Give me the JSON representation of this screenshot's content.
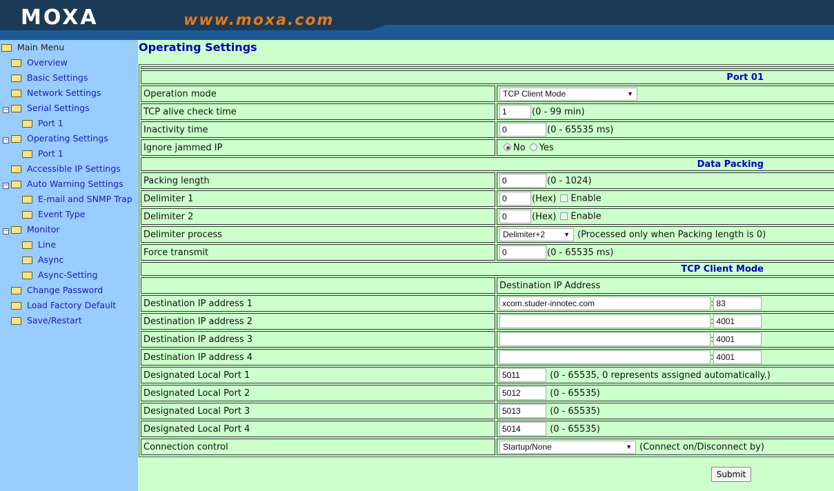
{
  "header": {
    "logo": "MOXA",
    "url": "www.moxa.com"
  },
  "sidebar": {
    "items": [
      {
        "label": "Main Menu",
        "level": 0,
        "root": true,
        "open": true
      },
      {
        "label": "Overview",
        "level": 1
      },
      {
        "label": "Basic Settings",
        "level": 1
      },
      {
        "label": "Network Settings",
        "level": 1
      },
      {
        "label": "Serial Settings",
        "level": 1,
        "open": true
      },
      {
        "label": "Port 1",
        "level": 2
      },
      {
        "label": "Operating Settings",
        "level": 1,
        "open": true
      },
      {
        "label": "Port 1",
        "level": 2
      },
      {
        "label": "Accessible IP Settings",
        "level": 1
      },
      {
        "label": "Auto Warning Settings",
        "level": 1,
        "open": true
      },
      {
        "label": "E-mail and SNMP Trap",
        "level": 2
      },
      {
        "label": "Event Type",
        "level": 2
      },
      {
        "label": "Monitor",
        "level": 1,
        "open": true
      },
      {
        "label": "Line",
        "level": 2
      },
      {
        "label": "Async",
        "level": 2
      },
      {
        "label": "Async-Setting",
        "level": 2
      },
      {
        "label": "Change Password",
        "level": 1
      },
      {
        "label": "Load Factory Default",
        "level": 1
      },
      {
        "label": "Save/Restart",
        "level": 1
      }
    ]
  },
  "page": {
    "title": "Operating Settings",
    "submit": "Submit"
  },
  "rows": [
    {
      "type": "blank"
    },
    {
      "type": "sec",
      "label": "Port 01"
    },
    {
      "type": "select",
      "label": "Operation mode",
      "value": "TCP Client Mode",
      "w": 200
    },
    {
      "type": "input",
      "label": "TCP alive check time",
      "value": "1",
      "w": 46,
      "hint": "(0 - 99 min)"
    },
    {
      "type": "input",
      "label": "Inactivity time",
      "value": "0",
      "w": 68,
      "hint": "(0 - 65535 ms)"
    },
    {
      "type": "radio",
      "label": "Ignore jammed IP",
      "options": [
        "No",
        "Yes"
      ],
      "selected": "No"
    },
    {
      "type": "sec",
      "label": "Data Packing"
    },
    {
      "type": "input",
      "label": "Packing length",
      "value": "0",
      "w": 68,
      "hint": "(0 - 1024)"
    },
    {
      "type": "input",
      "label": "Delimiter 1",
      "value": "0",
      "w": 46,
      "hint": "(Hex)",
      "check": "Enable"
    },
    {
      "type": "input",
      "label": "Delimiter 2",
      "value": "0",
      "w": 46,
      "hint": "(Hex)",
      "check": "Enable"
    },
    {
      "type": "select",
      "label": "Delimiter process",
      "value": "Delimiter+2",
      "w": 108,
      "hint": "(Processed only when Packing length is 0)"
    },
    {
      "type": "input",
      "label": "Force transmit",
      "value": "0",
      "w": 68,
      "hint": "(0 - 65535 ms)"
    },
    {
      "type": "sec",
      "label": "TCP Client Mode"
    },
    {
      "type": "text",
      "label": "",
      "value": "Destination IP Address"
    },
    {
      "type": "ip",
      "label": "Destination IP address 1",
      "value": "xcom.studer-innotec.com",
      "port": "83"
    },
    {
      "type": "ip",
      "label": "Destination IP address 2",
      "value": "",
      "port": "4001"
    },
    {
      "type": "ip",
      "label": "Destination IP address 3",
      "value": "",
      "port": "4001"
    },
    {
      "type": "ip",
      "label": "Destination IP address 4",
      "value": "",
      "port": "4001"
    },
    {
      "type": "input",
      "label": "Designated Local Port 1",
      "value": "5011",
      "w": 68,
      "hint": " (0 - 65535, 0 represents assigned automatically.)"
    },
    {
      "type": "input",
      "label": "Designated Local Port 2",
      "value": "5012",
      "w": 68,
      "hint": " (0 - 65535)"
    },
    {
      "type": "input",
      "label": "Designated Local Port 3",
      "value": "5013",
      "w": 68,
      "hint": " (0 - 65535)"
    },
    {
      "type": "input",
      "label": "Designated Local Port 4",
      "value": "5014",
      "w": 68,
      "hint": " (0 - 65535)"
    },
    {
      "type": "select",
      "label": "Connection control",
      "value": "Startup/None",
      "w": 198,
      "hint": "(Connect on/Disconnect by)"
    }
  ]
}
